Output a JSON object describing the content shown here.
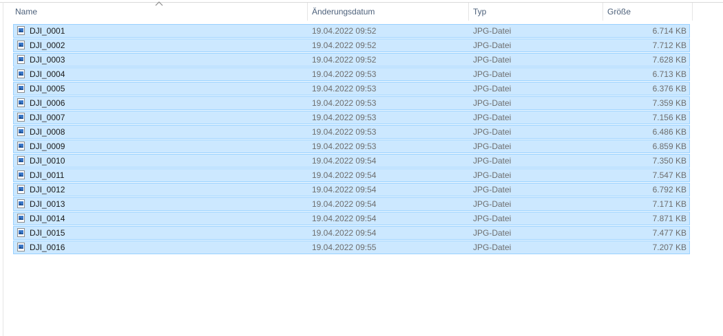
{
  "columns": {
    "name": "Name",
    "date": "Änderungsdatum",
    "type": "Typ",
    "size": "Größe"
  },
  "sort": {
    "column": "name",
    "direction": "ascending",
    "icon": "chevron-up-icon"
  },
  "selection_color": "#cce8ff",
  "file_icon": "image-file-icon",
  "files": [
    {
      "name": "DJI_0001",
      "date": "19.04.2022 09:52",
      "type": "JPG-Datei",
      "size": "6.714 KB"
    },
    {
      "name": "DJI_0002",
      "date": "19.04.2022 09:52",
      "type": "JPG-Datei",
      "size": "7.712 KB"
    },
    {
      "name": "DJI_0003",
      "date": "19.04.2022 09:52",
      "type": "JPG-Datei",
      "size": "7.628 KB"
    },
    {
      "name": "DJI_0004",
      "date": "19.04.2022 09:53",
      "type": "JPG-Datei",
      "size": "6.713 KB"
    },
    {
      "name": "DJI_0005",
      "date": "19.04.2022 09:53",
      "type": "JPG-Datei",
      "size": "6.376 KB"
    },
    {
      "name": "DJI_0006",
      "date": "19.04.2022 09:53",
      "type": "JPG-Datei",
      "size": "7.359 KB"
    },
    {
      "name": "DJI_0007",
      "date": "19.04.2022 09:53",
      "type": "JPG-Datei",
      "size": "7.156 KB"
    },
    {
      "name": "DJI_0008",
      "date": "19.04.2022 09:53",
      "type": "JPG-Datei",
      "size": "6.486 KB"
    },
    {
      "name": "DJI_0009",
      "date": "19.04.2022 09:53",
      "type": "JPG-Datei",
      "size": "6.859 KB"
    },
    {
      "name": "DJI_0010",
      "date": "19.04.2022 09:54",
      "type": "JPG-Datei",
      "size": "7.350 KB"
    },
    {
      "name": "DJI_0011",
      "date": "19.04.2022 09:54",
      "type": "JPG-Datei",
      "size": "7.547 KB"
    },
    {
      "name": "DJI_0012",
      "date": "19.04.2022 09:54",
      "type": "JPG-Datei",
      "size": "6.792 KB"
    },
    {
      "name": "DJI_0013",
      "date": "19.04.2022 09:54",
      "type": "JPG-Datei",
      "size": "7.171 KB"
    },
    {
      "name": "DJI_0014",
      "date": "19.04.2022 09:54",
      "type": "JPG-Datei",
      "size": "7.871 KB"
    },
    {
      "name": "DJI_0015",
      "date": "19.04.2022 09:54",
      "type": "JPG-Datei",
      "size": "7.477 KB"
    },
    {
      "name": "DJI_0016",
      "date": "19.04.2022 09:55",
      "type": "JPG-Datei",
      "size": "7.207 KB"
    }
  ]
}
